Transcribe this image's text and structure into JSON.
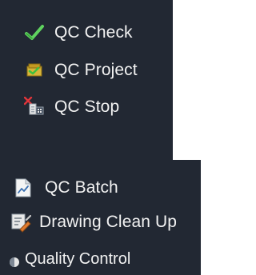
{
  "colors": {
    "panel_bg": "#222833",
    "text": "#f2f2f2",
    "check_green": "#5fd35f",
    "stop_red": "#e0353a"
  },
  "dropdown": {
    "items": [
      {
        "label": "QC Check",
        "icon": "check-icon"
      },
      {
        "label": "QC Project",
        "icon": "qc-project-icon"
      },
      {
        "label": "QC Stop",
        "icon": "qc-stop-icon"
      }
    ]
  },
  "panel": {
    "items": [
      {
        "label": "QC Batch",
        "icon": "qc-batch-icon"
      },
      {
        "label": "Drawing Clean Up",
        "icon": "drawing-clean-up-icon"
      }
    ],
    "title": {
      "label": "Quality Control",
      "icon": "quality-control-icon"
    }
  }
}
